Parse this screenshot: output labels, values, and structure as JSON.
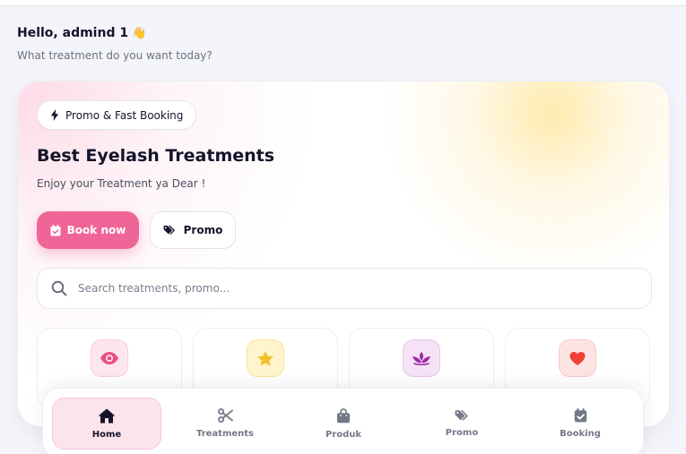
{
  "greeting": {
    "title": "Hello, admind 1",
    "wave_icon": "👋",
    "subtitle": "What treatment do you want today?"
  },
  "hero": {
    "badge": "Promo & Fast Booking",
    "title": "Best Eyelash Treatments",
    "subtitle": "Enjoy your Treatment ya Dear !",
    "book_label": "Book now",
    "promo_label": "Promo"
  },
  "search": {
    "placeholder": "Search treatments, promo..."
  },
  "categories": [
    {
      "icon": "eye-icon",
      "color": "#e84f7d"
    },
    {
      "icon": "star-icon",
      "color": "#f5c02f"
    },
    {
      "icon": "lotus-icon",
      "color": "#9b2aa3"
    },
    {
      "icon": "heart-icon",
      "color": "#ef4136"
    }
  ],
  "nav": {
    "items": [
      {
        "label": "Home",
        "icon": "home-icon",
        "active": true
      },
      {
        "label": "Treatments",
        "icon": "scissors-icon"
      },
      {
        "label": "Produk",
        "icon": "bag-icon"
      },
      {
        "label": "Promo",
        "icon": "tags-icon"
      },
      {
        "label": "Booking",
        "icon": "calendar-check-icon"
      }
    ]
  },
  "colors": {
    "accent": "#f06597",
    "text": "#14142b",
    "muted": "#747887",
    "active_nav_bg": "#fce4ec"
  }
}
